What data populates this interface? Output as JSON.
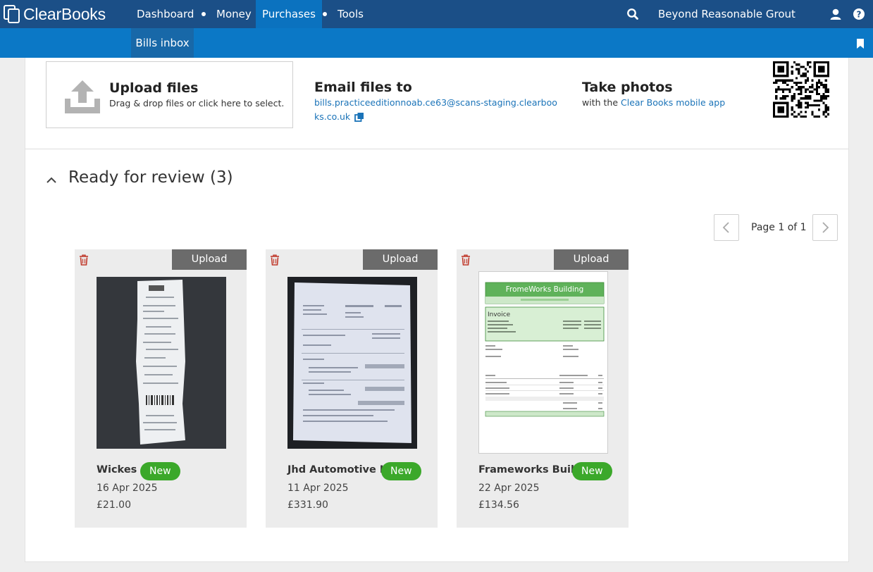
{
  "app": {
    "brand": "ClearBooks",
    "org_name": "Beyond Reasonable Grout"
  },
  "nav": {
    "items": [
      "Dashboard",
      "Money",
      "Purchases",
      "Tools"
    ],
    "active": "Purchases"
  },
  "subnav": {
    "items": [
      "Bills inbox"
    ],
    "active": "Bills inbox"
  },
  "upload": {
    "title": "Upload files",
    "subtitle": "Drag & drop files or click here to select."
  },
  "email": {
    "title": "Email files to",
    "address": "bills.practiceeditionnoab.ce63@scans-staging.clearbooks.co.uk"
  },
  "photos": {
    "title": "Take photos",
    "prefix": "with the",
    "link": "Clear Books mobile app"
  },
  "review": {
    "title": "Ready for review (3)",
    "pager": "Page 1 of 1",
    "upload_label": "Upload",
    "items": [
      {
        "name": "Wickes",
        "badge": "New",
        "date": "16 Apr 2025",
        "amount": "£21.00"
      },
      {
        "name": "Jhd Automotive L...",
        "badge": "New",
        "date": "11 Apr 2025",
        "amount": "£331.90"
      },
      {
        "name": "Frameworks Buil...",
        "badge": "New",
        "date": "22 Apr 2025",
        "amount": "£134.56"
      }
    ],
    "invoice_preview": {
      "company": "FromeWorks Building",
      "heading": "Invoice"
    }
  },
  "colors": {
    "topbar": "#1b4f87",
    "subbar": "#0b78c6",
    "active_nav": "#0b72bf",
    "badge": "#3ba82a",
    "link": "#1a73b8",
    "trash": "#c0392b"
  },
  "icons": [
    "clearbooks-logo-icon",
    "search-icon",
    "user-icon",
    "help-icon",
    "bookmark-icon",
    "upload-icon",
    "copy-icon",
    "qr-code-icon",
    "chevron-up-icon",
    "chevron-left-icon",
    "chevron-right-icon",
    "trash-icon"
  ]
}
